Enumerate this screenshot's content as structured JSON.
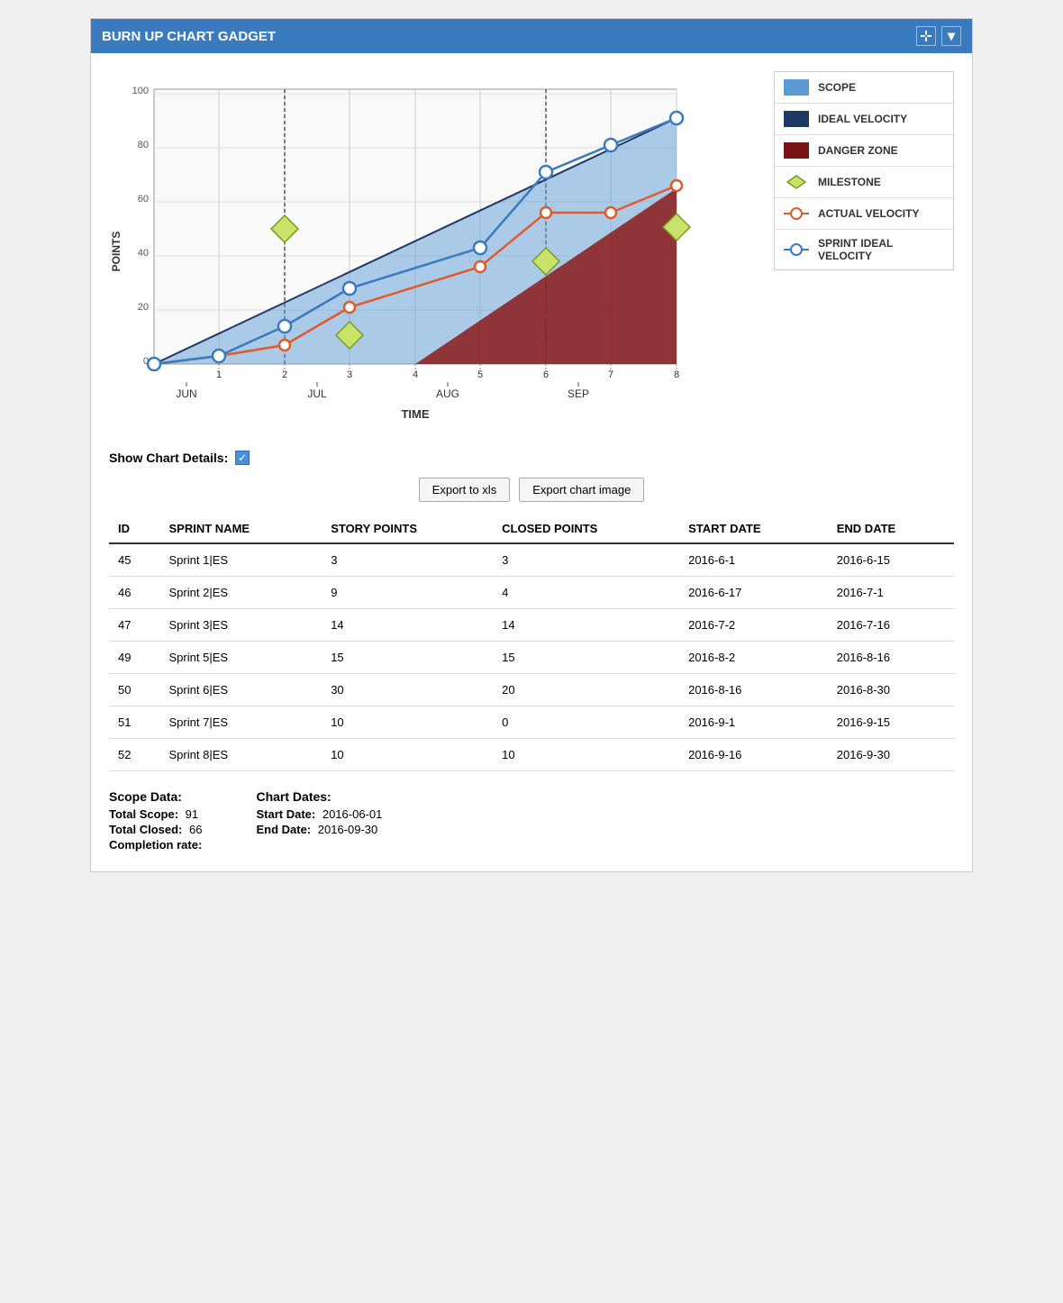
{
  "header": {
    "title": "BURN UP CHART GADGET",
    "icons": [
      "move-icon",
      "collapse-icon"
    ]
  },
  "legend": {
    "items": [
      {
        "label": "SCOPE",
        "color": "#5b9bd5",
        "type": "rect"
      },
      {
        "label": "IDEAL VELOCITY",
        "color": "#1f3864",
        "type": "rect"
      },
      {
        "label": "DANGER ZONE",
        "color": "#8b2020",
        "type": "rect"
      },
      {
        "label": "MILESTONE",
        "color": "#9dc242",
        "type": "diamond"
      },
      {
        "label": "ACTUAL VELOCITY",
        "color": "#e05a2b",
        "type": "circle"
      },
      {
        "label": "SPRINT IDEAL\nVELOCITY",
        "color": "#3a7bbf",
        "type": "circle"
      }
    ]
  },
  "chart_details": {
    "label": "Show Chart Details:",
    "checked": true
  },
  "buttons": {
    "export_xls": "Export to xls",
    "export_image": "Export chart image"
  },
  "table": {
    "columns": [
      "ID",
      "SPRINT NAME",
      "STORY POINTS",
      "CLOSED POINTS",
      "START DATE",
      "END DATE"
    ],
    "rows": [
      {
        "id": "45",
        "sprint_name": "Sprint 1|ES",
        "story_points": "3",
        "closed_points": "3",
        "start_date": "2016-6-1",
        "end_date": "2016-6-15"
      },
      {
        "id": "46",
        "sprint_name": "Sprint 2|ES",
        "story_points": "9",
        "closed_points": "4",
        "start_date": "2016-6-17",
        "end_date": "2016-7-1"
      },
      {
        "id": "47",
        "sprint_name": "Sprint 3|ES",
        "story_points": "14",
        "closed_points": "14",
        "start_date": "2016-7-2",
        "end_date": "2016-7-16"
      },
      {
        "id": "49",
        "sprint_name": "Sprint 5|ES",
        "story_points": "15",
        "closed_points": "15",
        "start_date": "2016-8-2",
        "end_date": "2016-8-16"
      },
      {
        "id": "50",
        "sprint_name": "Sprint 6|ES",
        "story_points": "30",
        "closed_points": "20",
        "start_date": "2016-8-16",
        "end_date": "2016-8-30"
      },
      {
        "id": "51",
        "sprint_name": "Sprint 7|ES",
        "story_points": "10",
        "closed_points": "0",
        "start_date": "2016-9-1",
        "end_date": "2016-9-15"
      },
      {
        "id": "52",
        "sprint_name": "Sprint 8|ES",
        "story_points": "10",
        "closed_points": "10",
        "start_date": "2016-9-16",
        "end_date": "2016-9-30"
      }
    ]
  },
  "footer": {
    "scope_title": "Scope Data:",
    "total_scope_label": "Total Scope:",
    "total_scope_value": "91",
    "total_closed_label": "Total Closed:",
    "total_closed_value": "66",
    "completion_label": "Completion rate:",
    "chart_dates_title": "Chart Dates:",
    "start_date_label": "Start Date:",
    "start_date_value": "2016-06-01",
    "end_date_label": "End Date:",
    "end_date_value": "2016-09-30"
  },
  "chart": {
    "y_label": "POINTS",
    "x_label": "TIME",
    "y_max": 100,
    "x_ticks": [
      "1",
      "2",
      "3",
      "4",
      "5",
      "6",
      "7",
      "8"
    ],
    "month_labels": [
      "JUN",
      "JUL",
      "AUG",
      "SEP"
    ]
  }
}
